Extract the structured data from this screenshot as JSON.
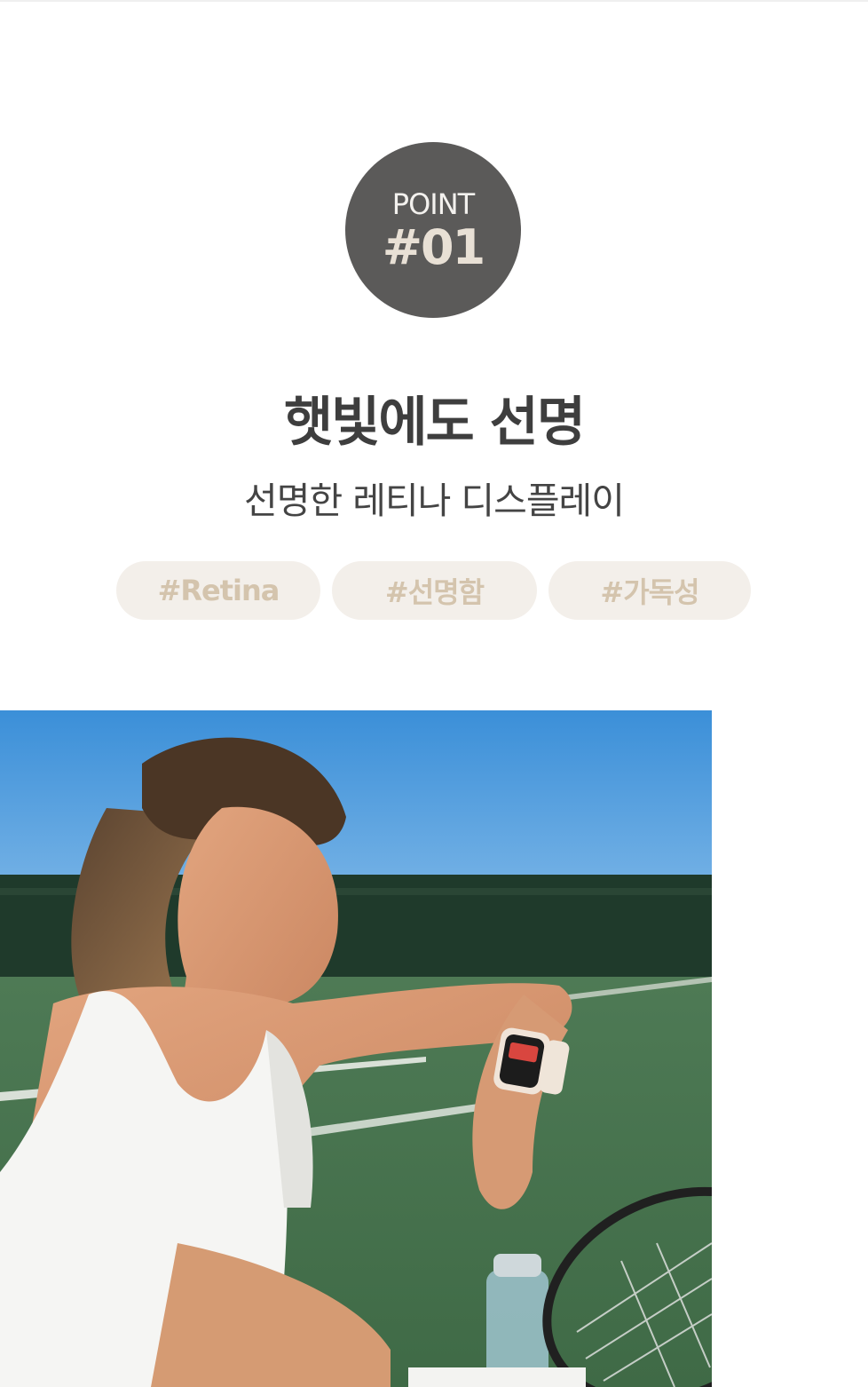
{
  "badge": {
    "label": "POINT",
    "number": "#01"
  },
  "headline": "햇빛에도 선명",
  "subheadline": "선명한 레티나 디스플레이",
  "tags": [
    "#Retina",
    "#선명함",
    "#가독성"
  ],
  "photo": {
    "subject": "woman-tennis-court-smartwatch"
  },
  "colors": {
    "badge_bg": "#5b5a59",
    "tag_bg": "#f3efea",
    "tag_text": "#d4c4ad",
    "headline": "#3e3e3e"
  }
}
